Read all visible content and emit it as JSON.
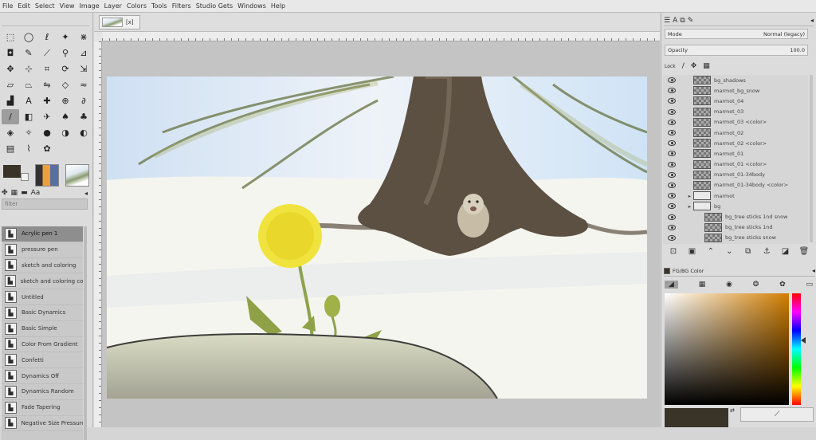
{
  "menu": [
    "File",
    "Edit",
    "Select",
    "View",
    "Image",
    "Layer",
    "Colors",
    "Tools",
    "Filters",
    "Studio Gets",
    "Windows",
    "Help"
  ],
  "image_tab": {
    "close": "[x]"
  },
  "toolbox": {
    "tools": [
      {
        "icon": "rect-select-icon",
        "glyph": "⬚"
      },
      {
        "icon": "ellipse-select-icon",
        "glyph": "◯"
      },
      {
        "icon": "lasso-icon",
        "glyph": "ℓ"
      },
      {
        "icon": "fuzzy-select-icon",
        "glyph": "✦"
      },
      {
        "icon": "scissors-select-icon",
        "glyph": "⋇"
      },
      {
        "icon": "foreground-select-icon",
        "glyph": "◘"
      },
      {
        "icon": "paths-icon",
        "glyph": "✎"
      },
      {
        "icon": "color-picker-icon",
        "glyph": "⟋"
      },
      {
        "icon": "zoom-icon",
        "glyph": "⚲"
      },
      {
        "icon": "measure-icon",
        "glyph": "⊿"
      },
      {
        "icon": "move-icon",
        "glyph": "✥"
      },
      {
        "icon": "align-icon",
        "glyph": "⊹"
      },
      {
        "icon": "crop-icon",
        "glyph": "⌗"
      },
      {
        "icon": "rotate-icon",
        "glyph": "⟳"
      },
      {
        "icon": "scale-icon",
        "glyph": "⇲"
      },
      {
        "icon": "shear-icon",
        "glyph": "▱"
      },
      {
        "icon": "perspective-icon",
        "glyph": "⏢"
      },
      {
        "icon": "flip-icon",
        "glyph": "⇋"
      },
      {
        "icon": "cage-icon",
        "glyph": "◇"
      },
      {
        "icon": "warp-icon",
        "glyph": "≈"
      },
      {
        "icon": "bucket-fill-icon",
        "glyph": "▟"
      },
      {
        "icon": "text-icon",
        "glyph": "A"
      },
      {
        "icon": "heal-icon",
        "glyph": "✚"
      },
      {
        "icon": "clone-icon",
        "glyph": "⊕"
      },
      {
        "icon": "smudge-icon",
        "glyph": "∂"
      },
      {
        "icon": "paintbrush-icon",
        "glyph": "/"
      },
      {
        "icon": "eraser-icon",
        "glyph": "◧"
      },
      {
        "icon": "airbrush-icon",
        "glyph": "✈"
      },
      {
        "icon": "ink-icon",
        "glyph": "♠"
      },
      {
        "icon": "mypaint-brush-icon",
        "glyph": "♣"
      },
      {
        "icon": "blur-icon",
        "glyph": "◈"
      },
      {
        "icon": "sharpen-icon",
        "glyph": "✧"
      },
      {
        "icon": "dodge-icon",
        "glyph": "●"
      },
      {
        "icon": "burn-icon",
        "glyph": "◑"
      },
      {
        "icon": "color-balance-icon",
        "glyph": "◐"
      },
      {
        "icon": "levels-icon",
        "glyph": "▤"
      },
      {
        "icon": "curves-icon",
        "glyph": "⌇"
      },
      {
        "icon": "hue-icon",
        "glyph": "✿"
      }
    ],
    "fg_color": "#3a3328",
    "bg_color": "#f1f1f1",
    "brush_tabs": [
      "brushes-tab",
      "patterns-tab",
      "gradients-tab",
      "fonts-tab"
    ],
    "filter_placeholder": "filter",
    "brushes": [
      {
        "label": "Acrylic pen 1",
        "selected": true
      },
      {
        "label": "pressure pen",
        "selected": false
      },
      {
        "label": "sketch and coloring",
        "selected": false
      },
      {
        "label": "sketch and coloring copy",
        "selected": false
      },
      {
        "label": "Untitled",
        "selected": false
      },
      {
        "label": "Basic Dynamics",
        "selected": false
      },
      {
        "label": "Basic Simple",
        "selected": false
      },
      {
        "label": "Color From Gradient",
        "selected": false
      },
      {
        "label": "Confetti",
        "selected": false
      },
      {
        "label": "Dynamics Off",
        "selected": false
      },
      {
        "label": "Dynamics Random",
        "selected": false
      },
      {
        "label": "Fade Tapering",
        "selected": false
      },
      {
        "label": "Negative Size Pressure",
        "selected": false
      }
    ]
  },
  "layers": {
    "mode_label": "Mode",
    "mode_value": "Normal (legacy)",
    "opacity_label": "Opacity",
    "opacity_value": "100.0",
    "lock_label": "Lock",
    "items": [
      {
        "name": "bg_shadows",
        "indent": 0,
        "folder": false
      },
      {
        "name": "marmot_bg_snow",
        "indent": 0,
        "folder": false
      },
      {
        "name": "marmot_04",
        "indent": 0,
        "folder": false
      },
      {
        "name": "marmot_03",
        "indent": 0,
        "folder": false
      },
      {
        "name": "marmot_03 <color>",
        "indent": 0,
        "folder": false
      },
      {
        "name": "marmot_02",
        "indent": 0,
        "folder": false
      },
      {
        "name": "marmot_02 <color>",
        "indent": 0,
        "folder": false
      },
      {
        "name": "marmot_01",
        "indent": 0,
        "folder": false
      },
      {
        "name": "marmot_01 <color>",
        "indent": 0,
        "folder": false
      },
      {
        "name": "marmot_01-34body",
        "indent": 0,
        "folder": false
      },
      {
        "name": "marmot_01-34body <color>",
        "indent": 0,
        "folder": false
      },
      {
        "name": "marmot",
        "indent": 0,
        "folder": true
      },
      {
        "name": "bg",
        "indent": 0,
        "folder": true
      },
      {
        "name": "bg_tree sticks 1nd snow",
        "indent": 1,
        "folder": false
      },
      {
        "name": "bg_tree sticks 1nd",
        "indent": 1,
        "folder": false
      },
      {
        "name": "bg_tree sticks snow",
        "indent": 1,
        "folder": false
      }
    ]
  },
  "color_panel": {
    "tab_label": "FG/BG Color",
    "swatch_fg": "#3a3328"
  }
}
